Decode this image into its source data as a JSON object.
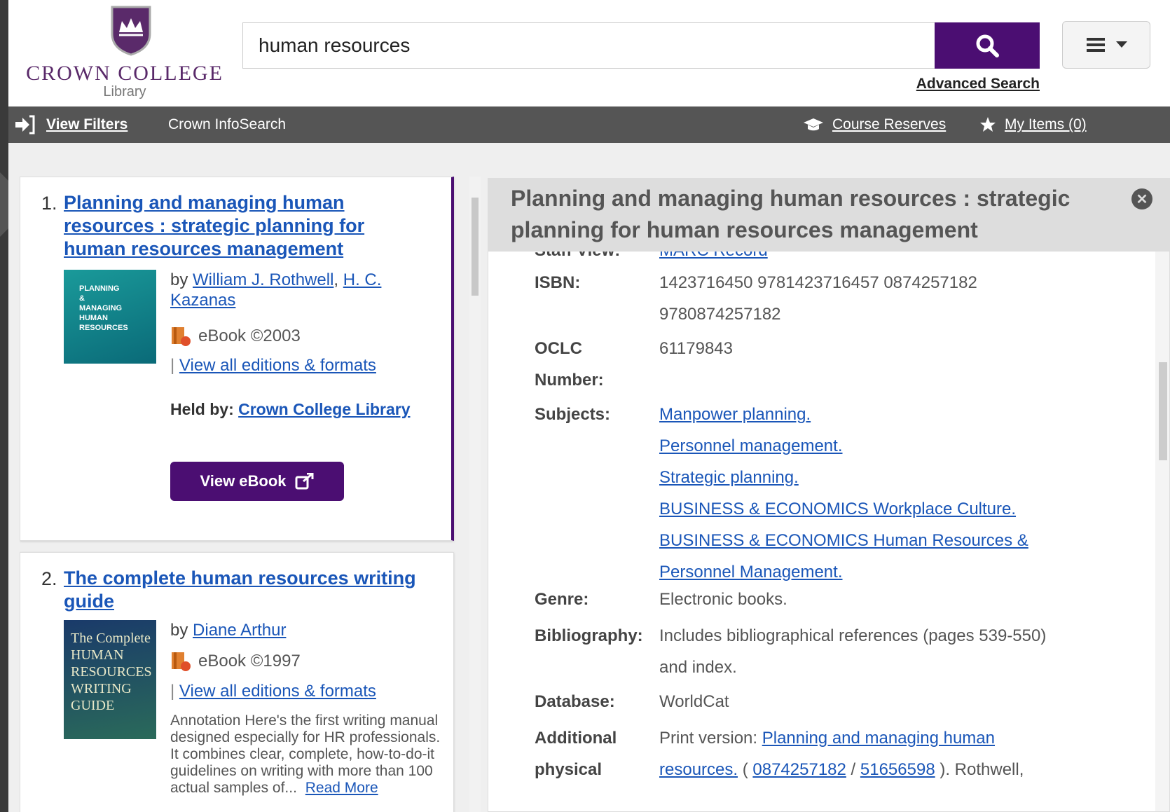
{
  "logo": {
    "college_name": "CROWN COLLEGE",
    "library_label": "Library"
  },
  "search": {
    "query": "human resources",
    "advanced_label": "Advanced Search"
  },
  "navbar": {
    "view_filters": "View Filters",
    "infosearch": "Crown InfoSearch",
    "course_reserves": "Course Reserves",
    "my_items": "My Items (0)"
  },
  "results": [
    {
      "number": "1.",
      "title": "Planning and managing human resources : strategic planning for human resources management",
      "title_lines": [
        "Planning and managing human",
        "resources : strategic planning for",
        "human resources management"
      ],
      "by_prefix": "by",
      "authors": [
        "William J. Rothwell",
        "H. C. Kazanas"
      ],
      "format": "eBook ©2003",
      "editions": "View all editions & formats",
      "held_label": "Held by:",
      "held_by": "Crown College Library",
      "button": "View eBook",
      "cover_text": "PLANNING & MANAGING HUMAN RESOURCES"
    },
    {
      "number": "2.",
      "title": "The complete human resources writing guide",
      "title_lines": [
        "The complete human resources writing",
        "guide"
      ],
      "by_prefix": "by",
      "authors": [
        "Diane Arthur"
      ],
      "format": "eBook ©1997",
      "editions": "View all editions & formats",
      "annotation": "Annotation Here's the first writing manual designed especially for HR professionals. It combines clear, complete, how-to-do-it guidelines on writing with more than 100 actual samples of...",
      "read_more": "Read More",
      "cover_text": "The Complete HUMAN RESOURCES WRITING GUIDE"
    }
  ],
  "detail": {
    "title": "Planning and managing human resources : strategic planning for human resources management",
    "staff_view_label": "Staff View:",
    "staff_view_value": "MARC Record",
    "fields": {
      "isbn_label": "ISBN:",
      "isbn_line1": "1423716450 9781423716457 0874257182",
      "isbn_line2": "9780874257182",
      "oclc_label_1": "OCLC",
      "oclc_label_2": "Number:",
      "oclc_value": "61179843",
      "subjects_label": "Subjects:",
      "subjects": [
        "Manpower planning.",
        "Personnel management.",
        "Strategic planning.",
        "BUSINESS & ECONOMICS Workplace Culture.",
        "BUSINESS & ECONOMICS Human Resources &",
        "Personnel Management."
      ],
      "genre_label": "Genre:",
      "genre_value": "Electronic books.",
      "bibliography_label": "Bibliography:",
      "bibliography_line1": "Includes bibliographical references (pages 539-550)",
      "bibliography_line2": "and index.",
      "database_label": "Database:",
      "database_value": "WorldCat",
      "additional_label_1": "Additional",
      "additional_label_2": "physical",
      "additional_prefix": "Print version:",
      "additional_link": "Planning and managing human",
      "additional_line2_link1": "resources.",
      "additional_line2_sep1": "(",
      "additional_line2_link2": "0874257182",
      "additional_line2_sep2": "/",
      "additional_line2_link3": "51656598",
      "additional_line2_tail": "). Rothwell,"
    }
  },
  "icons": {
    "search": "search-icon",
    "menu": "hamburger-menu-icon",
    "filters": "sign-in-arrow-icon",
    "course": "graduation-cap-icon",
    "star": "star-icon",
    "ebook": "ebook-icon",
    "external": "external-link-icon",
    "close": "close-circle-icon"
  },
  "colors": {
    "brand_purple": "#4b0e72",
    "link_blue": "#1a56b8",
    "nav_gray": "#555555"
  }
}
